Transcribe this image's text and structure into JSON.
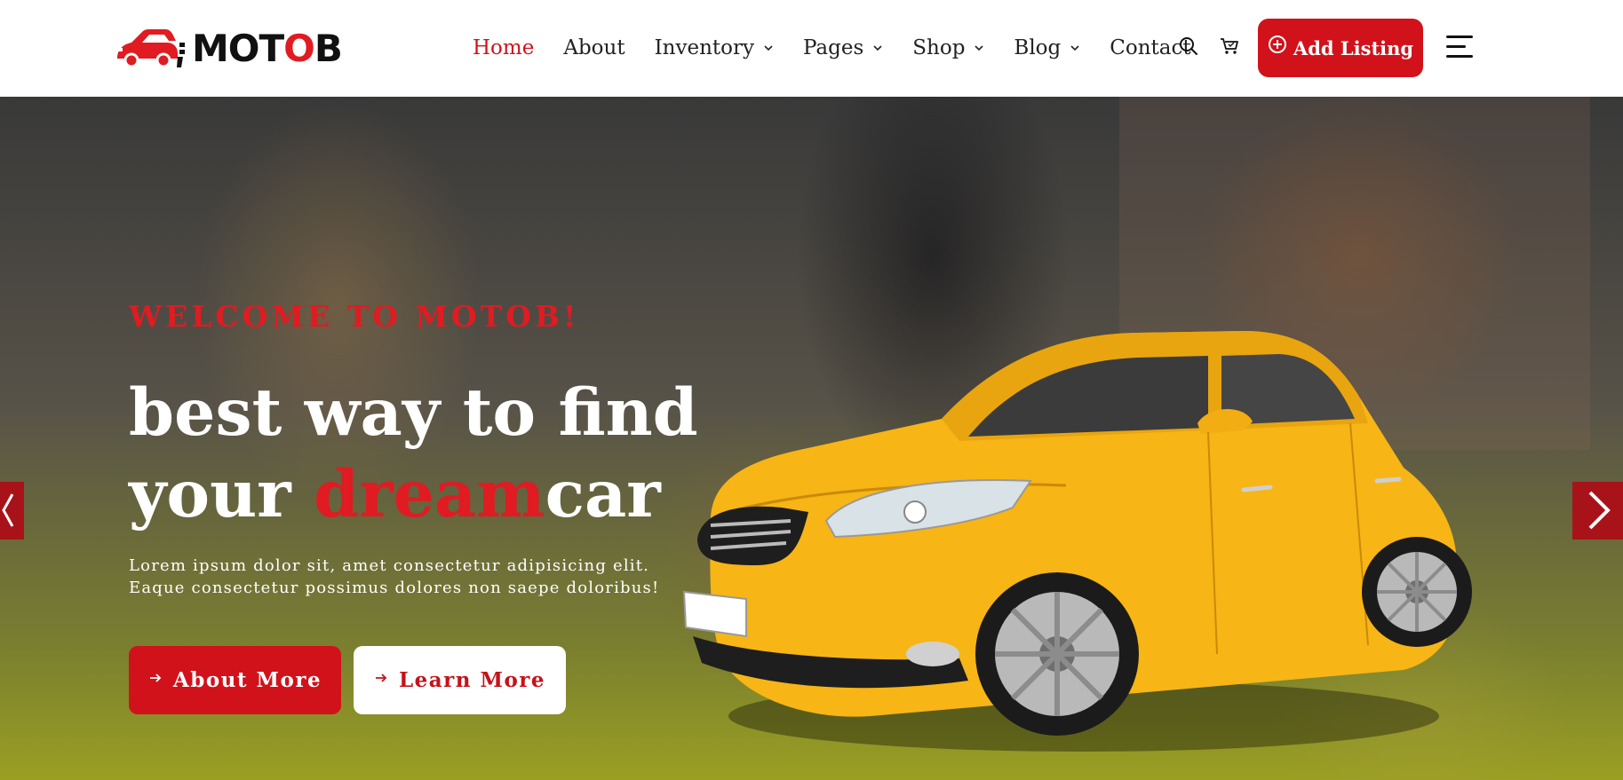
{
  "brand": {
    "name_prefix": "MOT",
    "name_o": "O",
    "name_suffix": "B",
    "accent_color": "#d1121b"
  },
  "nav": {
    "items": [
      {
        "label": "Home",
        "active": true,
        "dropdown": false
      },
      {
        "label": "About",
        "active": false,
        "dropdown": false
      },
      {
        "label": "Inventory",
        "active": false,
        "dropdown": true
      },
      {
        "label": "Pages",
        "active": false,
        "dropdown": true
      },
      {
        "label": "Shop",
        "active": false,
        "dropdown": true
      },
      {
        "label": "Blog",
        "active": false,
        "dropdown": true
      },
      {
        "label": "Contact",
        "active": false,
        "dropdown": false
      }
    ],
    "icons": [
      "search-icon",
      "cart-icon",
      "plus-circle-icon",
      "hamburger-menu-icon"
    ],
    "add_listing_label": "Add Listing"
  },
  "hero": {
    "welcome": "WELCOME TO MOTOB!",
    "headline_line1": "best way to find",
    "headline_line2_start": "your ",
    "headline_highlight": "dream",
    "headline_line2_end": "car",
    "description_line1": "Lorem ipsum dolor sit, amet consectetur adipisicing elit.",
    "description_line2": "Eaque consectetur possimus dolores non saepe doloribus!",
    "primary_button": "About More",
    "secondary_button": "Learn More",
    "slider_icons": [
      "chevron-left-icon",
      "chevron-right-icon"
    ],
    "car_color": "#f7b516"
  }
}
